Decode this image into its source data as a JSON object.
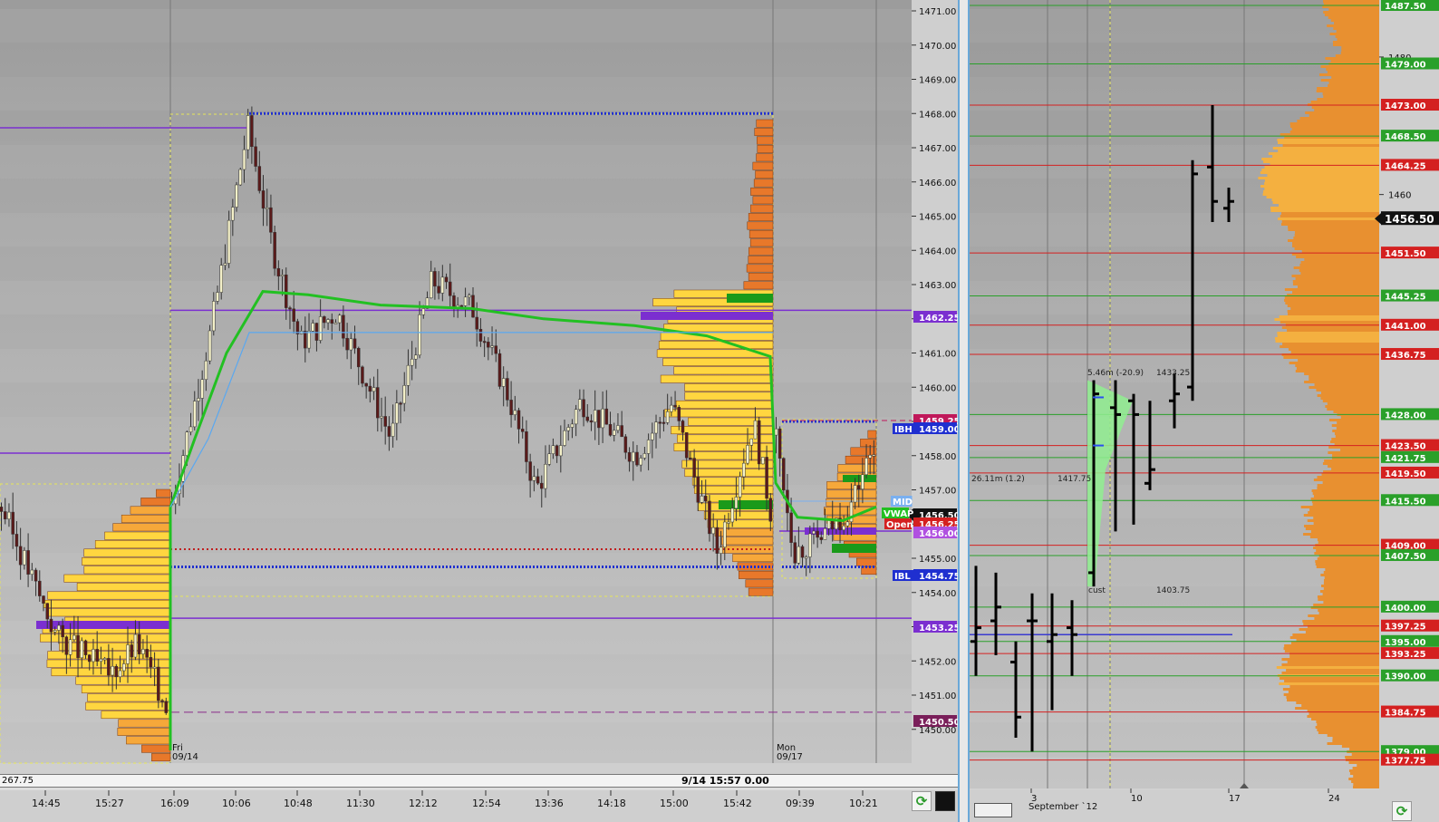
{
  "left_chart": {
    "price_axis_labels": [
      "1471.00",
      "1470.00",
      "1469.00",
      "1468.00",
      "1467.00",
      "1466.00",
      "1465.00",
      "1464.00",
      "1463.00",
      "1462.00",
      "1461.00",
      "1460.00",
      "1459.00",
      "1458.00",
      "1457.00",
      "1456.00",
      "1455.00",
      "1454.00",
      "1453.00",
      "1452.00",
      "1451.00",
      "1450.00"
    ],
    "time_axis_labels": [
      "14:45",
      "15:27",
      "16:09",
      "10:06",
      "10:48",
      "11:30",
      "12:12",
      "12:54",
      "13:36",
      "14:18",
      "15:00",
      "15:42",
      "09:39",
      "10:21"
    ],
    "day_labels": [
      {
        "day": "Fri",
        "date": "09/14"
      },
      {
        "day": "Mon",
        "date": "09/17"
      }
    ],
    "level_tags": [
      {
        "label": "1462.25",
        "color": "#7b2fd0",
        "text_color": "#ffffff"
      },
      {
        "label": "1459.25",
        "color": "#c0185a",
        "text_color": "#ffffff"
      },
      {
        "label": "1459.00",
        "color": "#1f2fd0",
        "text_color": "#ffffff"
      },
      {
        "label": "1456.50",
        "color": "#111111",
        "text_color": "#ffffff"
      },
      {
        "label": "1456.25",
        "color": "#d42020",
        "text_color": "#ffffff"
      },
      {
        "label": "1456.00",
        "color": "#b050e0",
        "text_color": "#ffffff"
      },
      {
        "label": "1454.75",
        "color": "#1f2fd0",
        "text_color": "#ffffff"
      },
      {
        "label": "1453.25",
        "color": "#7b2fd0",
        "text_color": "#ffffff"
      },
      {
        "label": "1450.50",
        "color": "#7a1f5a",
        "text_color": "#ffffff"
      }
    ],
    "side_tags": {
      "ibh": "IBH",
      "ibl": "IBL",
      "mid": "MID",
      "open": "Open",
      "vwap": "VWAP"
    },
    "status_left": "267.75",
    "status_mid": "9/14 15:57  0.00"
  },
  "right_chart": {
    "level_tags": [
      {
        "label": "1487.50",
        "color": "#2aa02a"
      },
      {
        "label": "1479.00",
        "color": "#2aa02a"
      },
      {
        "label": "1473.00",
        "color": "#d42020"
      },
      {
        "label": "1468.50",
        "color": "#2aa02a"
      },
      {
        "label": "1464.25",
        "color": "#d42020"
      },
      {
        "label": "1451.50",
        "color": "#d42020"
      },
      {
        "label": "1445.25",
        "color": "#2aa02a"
      },
      {
        "label": "1441.00",
        "color": "#d42020"
      },
      {
        "label": "1436.75",
        "color": "#d42020"
      },
      {
        "label": "1428.00",
        "color": "#2aa02a"
      },
      {
        "label": "1423.50",
        "color": "#d42020"
      },
      {
        "label": "1421.75",
        "color": "#2aa02a"
      },
      {
        "label": "1419.50",
        "color": "#d42020"
      },
      {
        "label": "1415.50",
        "color": "#2aa02a"
      },
      {
        "label": "1409.00",
        "color": "#d42020"
      },
      {
        "label": "1407.50",
        "color": "#2aa02a"
      },
      {
        "label": "1400.00",
        "color": "#2aa02a"
      },
      {
        "label": "1397.25",
        "color": "#d42020"
      },
      {
        "label": "1395.00",
        "color": "#2aa02a"
      },
      {
        "label": "1393.25",
        "color": "#d42020"
      },
      {
        "label": "1390.00",
        "color": "#2aa02a"
      },
      {
        "label": "1384.75",
        "color": "#d42020"
      },
      {
        "label": "1379.00",
        "color": "#2aa02a"
      },
      {
        "label": "1377.75",
        "color": "#d42020"
      }
    ],
    "axis_labels": [
      "1480",
      "1460"
    ],
    "current_price": "1456.50",
    "annotations": [
      "5.46m (-20.9)",
      "1433.25",
      "26.11m (1.2)",
      "1417.75",
      "cust",
      "1403.75"
    ],
    "date_axis_labels": [
      "3",
      "September `12",
      "10",
      "17",
      "24"
    ]
  },
  "chart_data": [
    {
      "type": "candlestick",
      "title": "",
      "ylim": [
        1449.5,
        1471.3
      ],
      "price_levels": {
        "prior_high": 1468.0,
        "poc": 1462.25,
        "ibh": 1459.0,
        "ibl": 1454.75,
        "open": 1456.25,
        "last": 1456.5,
        "vpoc_prior": 1453.25,
        "low_ref": 1450.5
      },
      "close_path": [
        {
          "x": "14:45",
          "y": 1453.2
        },
        {
          "x": "15:27",
          "y": 1451.2
        },
        {
          "x": "16:09",
          "y": 1450.5
        },
        {
          "x": "16:09",
          "y": 1456.5
        },
        {
          "x": "10:06",
          "y": 1467.3
        },
        {
          "x": "10:48",
          "y": 1462.3
        },
        {
          "x": "11:30",
          "y": 1459.0
        },
        {
          "x": "12:12",
          "y": 1462.7
        },
        {
          "x": "12:54",
          "y": 1461.2
        },
        {
          "x": "13:36",
          "y": 1459.3
        },
        {
          "x": "14:18",
          "y": 1458.6
        },
        {
          "x": "15:00",
          "y": 1456.0
        },
        {
          "x": "15:42",
          "y": 1455.3
        },
        {
          "x": "09:39",
          "y": 1455.5
        },
        {
          "x": "10:21",
          "y": 1456.5
        }
      ]
    },
    {
      "type": "bar",
      "title": "",
      "ylim": [
        1372,
        1490
      ],
      "x": [
        "3",
        "September `12",
        "10",
        "17",
        "24"
      ],
      "last": 1456.5,
      "ohlc": [
        {
          "o": 1395,
          "h": 1406,
          "l": 1390,
          "c": 1397
        },
        {
          "o": 1398,
          "h": 1405,
          "l": 1393,
          "c": 1400
        },
        {
          "o": 1392,
          "h": 1395,
          "l": 1381,
          "c": 1384
        },
        {
          "o": 1398,
          "h": 1402,
          "l": 1379,
          "c": 1398
        },
        {
          "o": 1395,
          "h": 1402,
          "l": 1385,
          "c": 1396
        },
        {
          "o": 1397,
          "h": 1401,
          "l": 1390,
          "c": 1396
        },
        {
          "o": 1405,
          "h": 1433,
          "l": 1403,
          "c": 1431
        },
        {
          "o": 1429,
          "h": 1433,
          "l": 1411,
          "c": 1428
        },
        {
          "o": 1430,
          "h": 1431,
          "l": 1412,
          "c": 1428
        },
        {
          "o": 1418,
          "h": 1430,
          "l": 1417,
          "c": 1420
        },
        {
          "o": 1430,
          "h": 1434,
          "l": 1426,
          "c": 1431
        },
        {
          "o": 1432,
          "h": 1465,
          "l": 1430,
          "c": 1463
        },
        {
          "o": 1464,
          "h": 1473,
          "l": 1456,
          "c": 1459
        },
        {
          "o": 1458,
          "h": 1461,
          "l": 1456,
          "c": 1459
        }
      ]
    }
  ]
}
